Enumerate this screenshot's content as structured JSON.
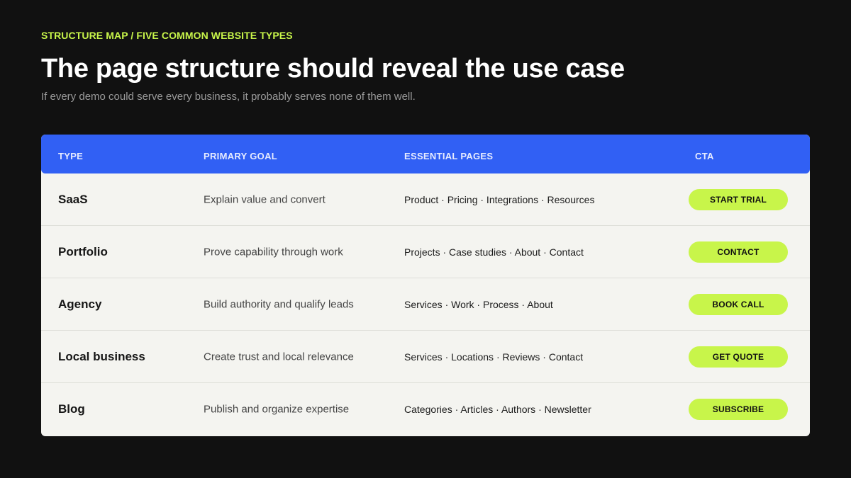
{
  "eyebrow": "STRUCTURE MAP / FIVE COMMON WEBSITE TYPES",
  "title": "The page structure should reveal the use case",
  "subtitle": "If every demo could serve every business, it probably serves none of them well.",
  "colors": {
    "background": "#111111",
    "accent": "#c8f54a",
    "header": "#3160f4",
    "table_bg": "#f4f4f0"
  },
  "table": {
    "headers": [
      "TYPE",
      "PRIMARY GOAL",
      "ESSENTIAL PAGES",
      "CTA"
    ],
    "rows": [
      {
        "type": "SaaS",
        "goal": "Explain value and convert",
        "pages": "Product · Pricing · Integrations · Resources",
        "cta": "START TRIAL"
      },
      {
        "type": "Portfolio",
        "goal": "Prove capability through work",
        "pages": "Projects · Case studies · About · Contact",
        "cta": "CONTACT"
      },
      {
        "type": "Agency",
        "goal": "Build authority and qualify leads",
        "pages": "Services · Work · Process · About",
        "cta": "BOOK CALL"
      },
      {
        "type": "Local business",
        "goal": "Create trust and local relevance",
        "pages": "Services · Locations · Reviews · Contact",
        "cta": "GET QUOTE"
      },
      {
        "type": "Blog",
        "goal": "Publish and organize expertise",
        "pages": "Categories · Articles · Authors · Newsletter",
        "cta": "SUBSCRIBE"
      }
    ]
  }
}
